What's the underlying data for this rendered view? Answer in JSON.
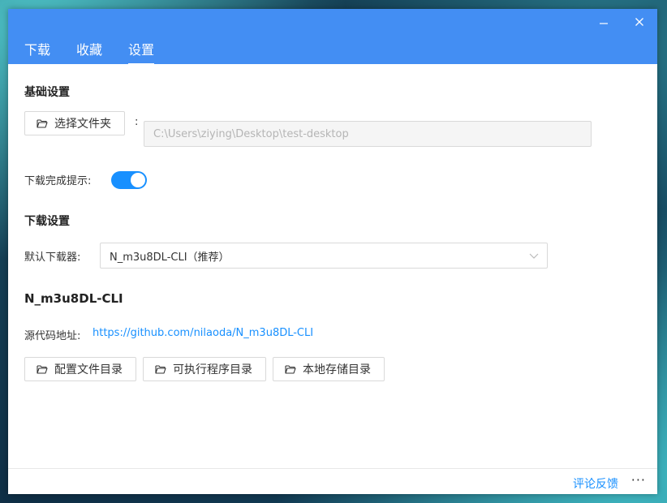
{
  "window": {
    "controls": {
      "minimize": "—",
      "close": "X"
    }
  },
  "tabs": [
    {
      "label": "下载",
      "active": false
    },
    {
      "label": "收藏",
      "active": false
    },
    {
      "label": "设置",
      "active": true
    }
  ],
  "basic": {
    "title": "基础设置",
    "select_folder_label": "选择文件夹",
    "colon": ":",
    "folder_path": "C:\\Users\\ziying\\Desktop\\test-desktop",
    "notify_label": "下载完成提示:",
    "notify_enabled": true
  },
  "download": {
    "title": "下载设置",
    "downloader_label": "默认下载器:",
    "downloader_value": "N_m3u8DL-CLI（推荐）"
  },
  "tool": {
    "title": "N_m3u8DL-CLI",
    "source_label": "源代码地址:",
    "source_url": "https://github.com/nilaoda/N_m3u8DL-CLI",
    "buttons": {
      "config_dir": "配置文件目录",
      "exe_dir": "可执行程序目录",
      "local_dir": "本地存储目录"
    }
  },
  "footer": {
    "feedback": "评论反馈",
    "more": "···"
  },
  "colors": {
    "titlebar": "#438ef3",
    "accent": "#1890ff"
  },
  "icons": [
    "minimize-icon",
    "close-icon",
    "folder-open-icon",
    "chevron-down-icon",
    "more-icon"
  ]
}
